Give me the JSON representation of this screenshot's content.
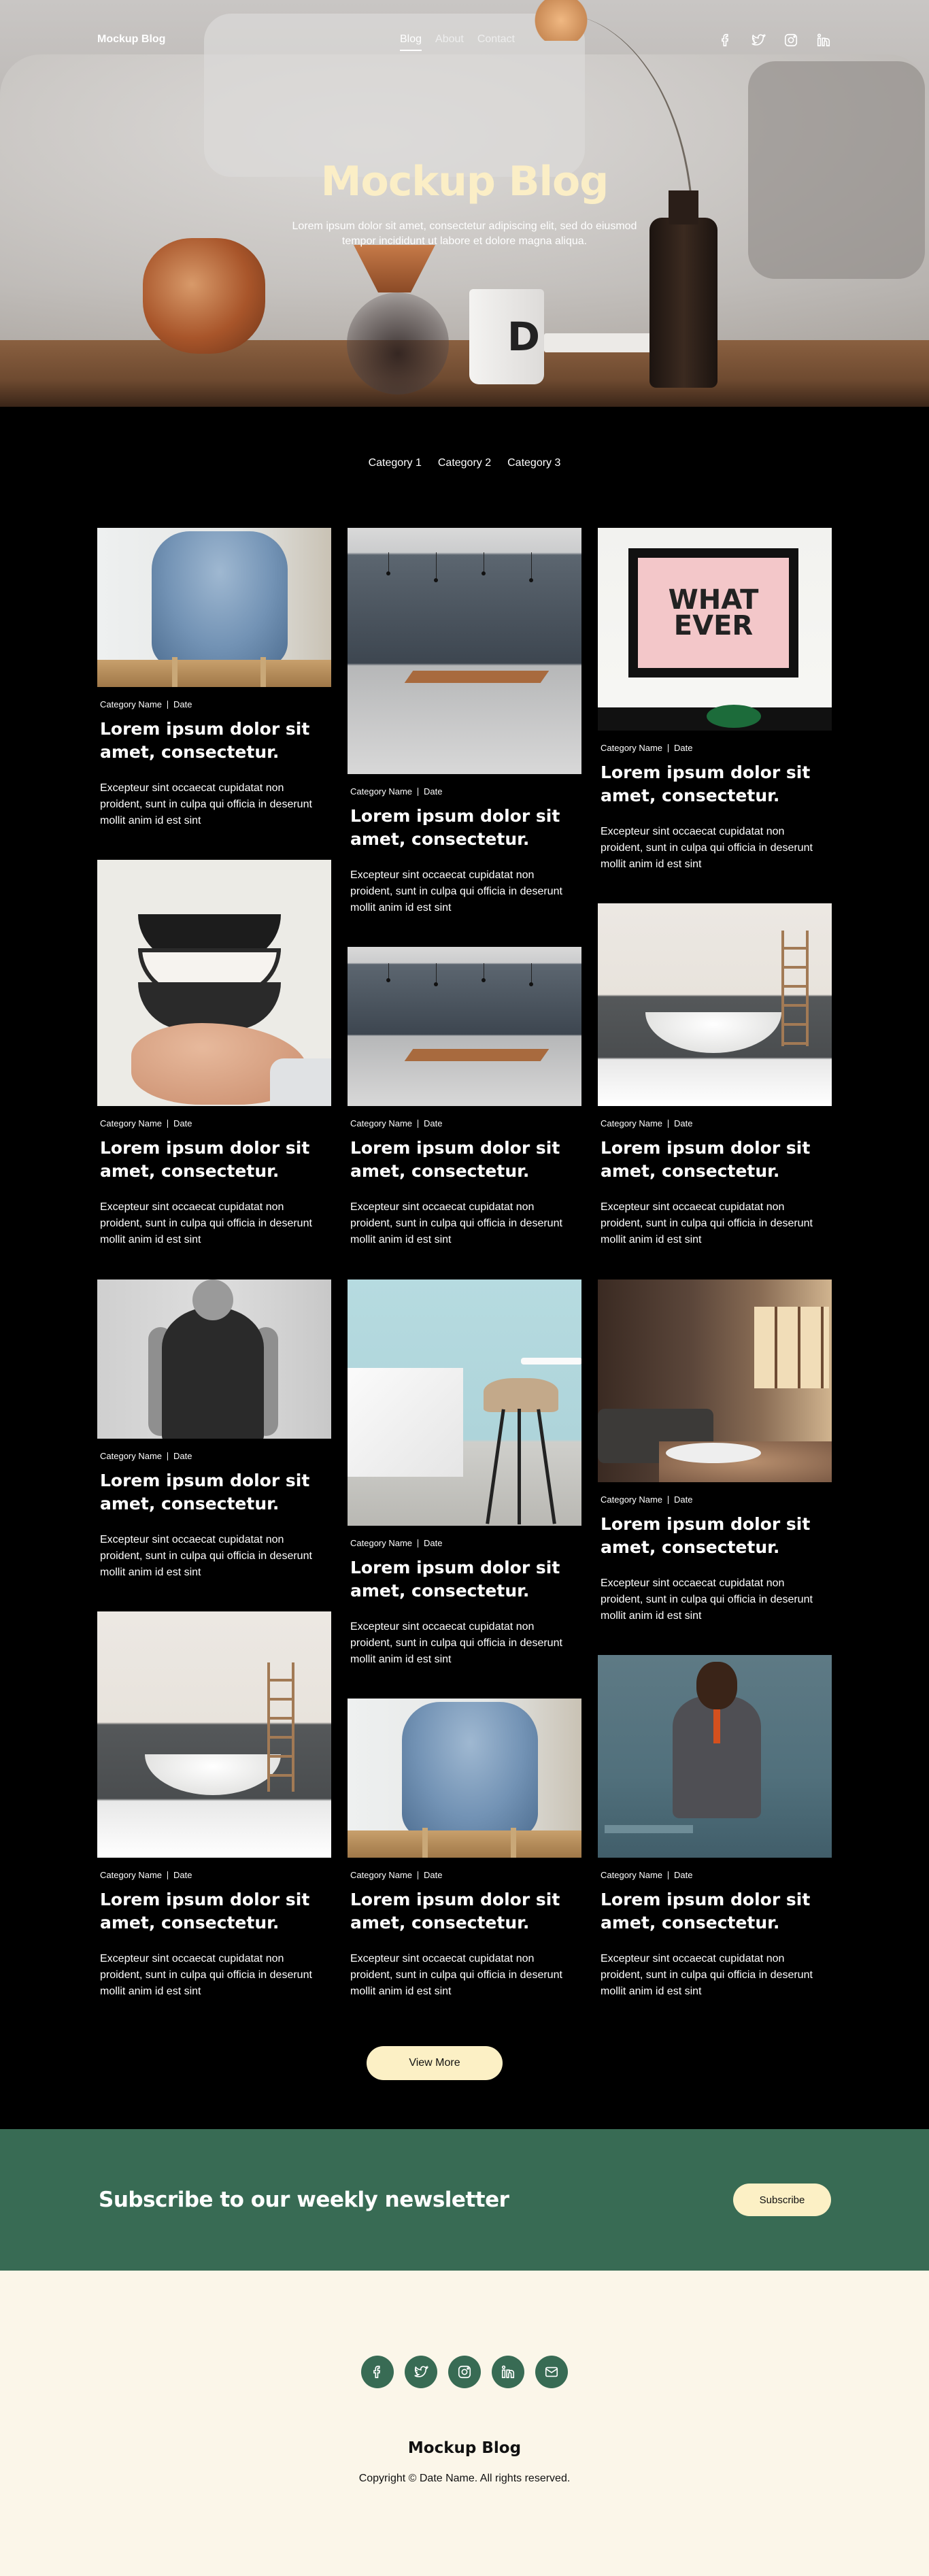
{
  "nav": {
    "logo": "Mockup Blog",
    "links": [
      "Blog",
      "About",
      "Contact"
    ],
    "active": "Blog"
  },
  "hero": {
    "title": "Mockup Blog",
    "subtitle": "Lorem ipsum dolor sit amet, consectetur adipiscing elit, sed do eiusmod tempor incididunt ut labore et dolore magna aliqua."
  },
  "categories": [
    "Category 1",
    "Category 2",
    "Category 3"
  ],
  "card_common": {
    "category": "Category Name",
    "date": "Date",
    "title": "Lorem ipsum dolor sit amet, consectetur.",
    "excerpt": "Excepteur sint occaecat cupidatat non proident, sunt in culpa qui officia in deserunt mollit anim id est sint"
  },
  "cards": [
    {
      "image": "blue-armchair",
      "category": "Category Name",
      "date": "Date",
      "title": "Lorem ipsum dolor sit amet, consectetur.",
      "excerpt": "Excepteur sint occaecat cupidatat non proident, sunt in culpa qui officia in deserunt mollit anim id est sint"
    },
    {
      "image": "dining-room",
      "category": "Category Name",
      "date": "Date",
      "title": "Lorem ipsum dolor sit amet, consectetur.",
      "excerpt": "Excepteur sint occaecat cupidatat non proident, sunt in culpa qui officia in deserunt mollit anim id est sint"
    },
    {
      "image": "whatever-poster",
      "category": "Category Name",
      "date": "Date",
      "title": "Lorem ipsum dolor sit amet, consectetur.",
      "excerpt": "Excepteur sint occaecat cupidatat non proident, sunt in culpa qui officia in deserunt mollit anim id est sint"
    },
    {
      "image": "stacked-bowls",
      "category": "Category Name",
      "date": "Date",
      "title": "Lorem ipsum dolor sit amet, consectetur.",
      "excerpt": "Excepteur sint occaecat cupidatat non proident, sunt in culpa qui officia in deserunt mollit anim id est sint"
    },
    {
      "image": "dining-room",
      "category": "Category Name",
      "date": "Date",
      "title": "Lorem ipsum dolor sit amet, consectetur.",
      "excerpt": "Excepteur sint occaecat cupidatat non proident, sunt in culpa qui officia in deserunt mollit anim id est sint"
    },
    {
      "image": "bathtub",
      "category": "Category Name",
      "date": "Date",
      "title": "Lorem ipsum dolor sit amet, consectetur.",
      "excerpt": "Excepteur sint occaecat cupidatat non proident, sunt in culpa qui officia in deserunt mollit anim id est sint"
    },
    {
      "image": "person-portrait",
      "category": "Category Name",
      "date": "Date",
      "title": "Lorem ipsum dolor sit amet, consectetur.",
      "excerpt": "Excepteur sint occaecat cupidatat non proident, sunt in culpa qui officia in deserunt mollit anim id est sint"
    },
    {
      "image": "bar-stool",
      "category": "Category Name",
      "date": "Date",
      "title": "Lorem ipsum dolor sit amet, consectetur.",
      "excerpt": "Excepteur sint occaecat cupidatat non proident, sunt in culpa qui officia in deserunt mollit anim id est sint"
    },
    {
      "image": "living-room",
      "category": "Category Name",
      "date": "Date",
      "title": "Lorem ipsum dolor sit amet, consectetur.",
      "excerpt": "Excepteur sint occaecat cupidatat non proident, sunt in culpa qui officia in deserunt mollit anim id est sint"
    },
    {
      "image": "bathtub",
      "category": "Category Name",
      "date": "Date",
      "title": "Lorem ipsum dolor sit amet, consectetur.",
      "excerpt": "Excepteur sint occaecat cupidatat non proident, sunt in culpa qui officia in deserunt mollit anim id est sint"
    },
    {
      "image": "blue-armchair",
      "category": "Category Name",
      "date": "Date",
      "title": "Lorem ipsum dolor sit amet, consectetur.",
      "excerpt": "Excepteur sint occaecat cupidatat non proident, sunt in culpa qui officia in deserunt mollit anim id est sint"
    },
    {
      "image": "man-in-vest",
      "category": "Category Name",
      "date": "Date",
      "title": "Lorem ipsum dolor sit amet, consectetur.",
      "excerpt": "Excepteur sint occaecat cupidatat non proident, sunt in culpa qui officia in deserunt mollit anim id est sint"
    }
  ],
  "view_more": "View More",
  "newsletter": {
    "heading": "Subscribe to our weekly newsletter",
    "button": "Subscribe"
  },
  "footer": {
    "title": "Mockup Blog",
    "copyright": "Copyright © Date Name. All rights reserved.",
    "social_icons": [
      "facebook-icon",
      "twitter-icon",
      "instagram-icon",
      "linkedin-icon",
      "mail-icon"
    ]
  },
  "colors": {
    "accent": "#fcf0c5",
    "newsletter_bg": "#386b54",
    "footer_bg": "#fbf6e9",
    "page_bg": "#000000"
  }
}
